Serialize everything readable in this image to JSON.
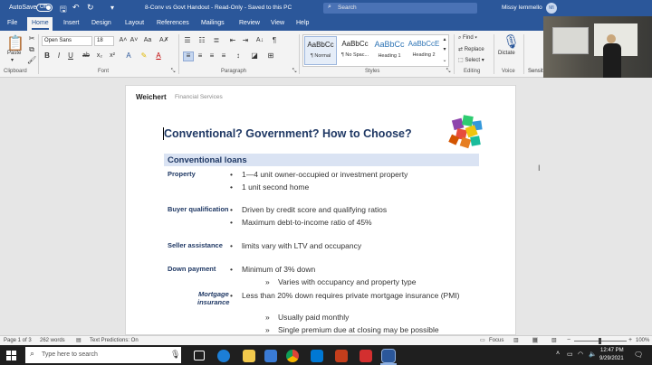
{
  "titlebar": {
    "autosave_label": "AutoSave",
    "autosave_state": "Off",
    "document_title": "8-Conv vs Govt Handout  -  Read-Only  -  Saved to this PC",
    "search_placeholder": "Search",
    "user_name": "Missy Iemmello",
    "user_initials": "MI"
  },
  "menu": {
    "tabs": [
      "File",
      "Home",
      "Insert",
      "Design",
      "Layout",
      "References",
      "Mailings",
      "Review",
      "View",
      "Help"
    ],
    "active": "Home"
  },
  "ribbon": {
    "clipboard": {
      "paste_label": "Paste",
      "group_label": "Clipboard"
    },
    "font": {
      "font_name": "Open Sans",
      "font_size": "18",
      "group_label": "Font"
    },
    "paragraph": {
      "group_label": "Paragraph"
    },
    "styles": {
      "group_label": "Styles",
      "items": [
        {
          "sample": "AaBbCc",
          "name": "¶ Normal"
        },
        {
          "sample": "AaBbCc",
          "name": "¶ No Spac..."
        },
        {
          "sample": "AaBbCc",
          "name": "Heading 1"
        },
        {
          "sample": "AaBbCcE",
          "name": "Heading 2"
        }
      ]
    },
    "editing": {
      "find": "Find",
      "replace": "Replace",
      "select": "Select",
      "group_label": "Editing"
    },
    "voice": {
      "dictate": "Dictate",
      "group_label": "Voice"
    },
    "sensitivity_partial": "Sensiti"
  },
  "document": {
    "logo_brand": "Weichert",
    "logo_sub": "Financial Services",
    "heading": "Conventional?   Government?  How to Choose?",
    "section_title": "Conventional loans",
    "rows": [
      {
        "label": "Property",
        "bullets": [
          "1—4 unit owner-occupied or investment property",
          "1 unit second home"
        ]
      },
      {
        "label": "Buyer qualification",
        "bullets": [
          "Driven by credit score and qualifying ratios",
          "Maximum debt-to-income ratio of 45%"
        ]
      },
      {
        "label": "Seller assistance",
        "bullets": [
          "limits vary with LTV and occupancy"
        ]
      },
      {
        "label": "Down payment",
        "bullets": [
          "Minimum of 3% down"
        ],
        "subs": [
          "Varies with occupancy and property type"
        ]
      }
    ],
    "mortgage_label_line1": "Mortgage",
    "mortgage_label_line2": "insurance",
    "pmi_bullet": "Less than 20% down requires private mortgage insurance (PMI)",
    "pmi_subs": [
      "Usually paid monthly",
      "Single premium due at closing may be possible"
    ]
  },
  "status": {
    "page": "Page 1 of 3",
    "words": "262 words",
    "predictions": "Text Predictions: On",
    "focus": "Focus",
    "zoom": "100%"
  },
  "taskbar": {
    "search_placeholder": "Type here to search",
    "time": "12:47 PM",
    "date": "9/29/2021"
  },
  "colors": {
    "word_blue": "#2b579a",
    "heading_navy": "#1f3864",
    "section_band": "#dae3f3",
    "taskbar": "#1f1f1f"
  }
}
